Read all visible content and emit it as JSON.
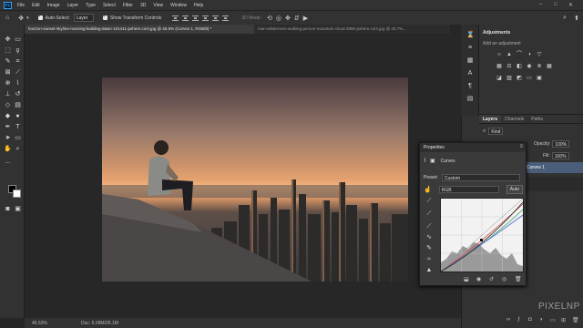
{
  "menubar": {
    "logo": "Ps",
    "items": [
      "File",
      "Edit",
      "Image",
      "Layer",
      "Type",
      "Select",
      "Filter",
      "3D",
      "View",
      "Window",
      "Help"
    ]
  },
  "options": {
    "auto_select_label": "Auto-Select:",
    "auto_select_value": "Layer",
    "show_transform": "Show Transform Controls",
    "mode_3d": "3D Mode:"
  },
  "tabs": [
    "horizon-sunset-skyline-morning-building-dawn-101411-pxhere.com.jpg @ 46.5% (Curves 1, RGB/8) *",
    "man-wilderness-walking-person-mountain-cloud-3896-pxhere.com.jpg @ 40.7%..."
  ],
  "status": {
    "zoom": "46.53%",
    "doc": "Doc: 6.09M/26.1M"
  },
  "adjustments": {
    "title": "Adjustments",
    "subtitle": "Add an adjustment"
  },
  "layers": {
    "tabs": [
      "Layers",
      "Channels",
      "Paths"
    ],
    "kind": "Kind",
    "opacity_label": "Opacity:",
    "opacity_value": "100%",
    "fill_label": "Fill:",
    "fill_value": "100%",
    "selected_layer": "Curves 1"
  },
  "properties": {
    "title": "Properties",
    "section": "Curves",
    "preset_label": "Preset:",
    "preset_value": "Custom",
    "channel_value": "RGB",
    "auto_label": "Auto"
  },
  "watermark": "PIXELNP"
}
